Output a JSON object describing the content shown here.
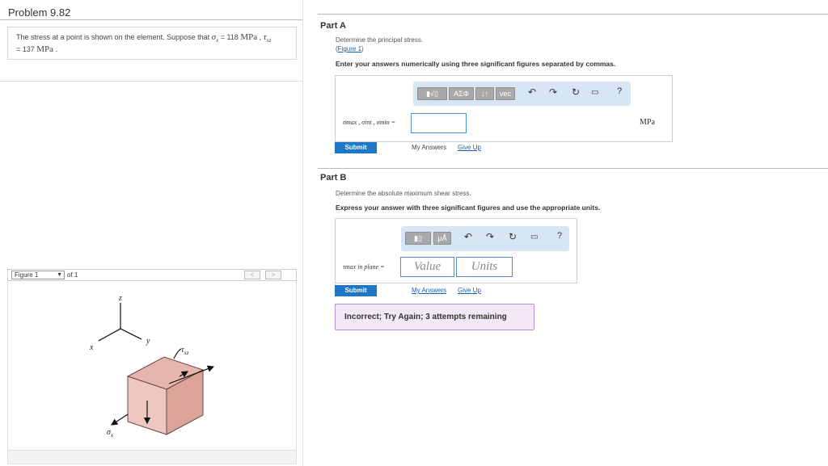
{
  "problem": {
    "title": "Problem 9.82"
  },
  "statement": {
    "text1": "The stress at a point is shown on the element. Suppose that ",
    "sigma_sym": "σ",
    "sigma_sub": "x",
    "sigma_val": " = 118 ",
    "unit": "MPa",
    "sep": " , ",
    "tau_sym": "τ",
    "tau_sub": "xz",
    "tau_val": " = 137 ",
    "end": " ."
  },
  "figure_panel": {
    "selector_value": "Figure 1",
    "of_text": "of 1",
    "prev": "<",
    "next": ">",
    "axis_z": "z",
    "axis_y": "y",
    "axis_x": "x",
    "tau_label": "τ",
    "tau_label_sub": "xz",
    "sigma_label": "σ",
    "sigma_label_sub": "x"
  },
  "partA": {
    "label": "Part A",
    "question": "Determine the principal stress.",
    "figure_link": "Figure 1",
    "instruction": "Enter your answers numerically using three significant figures separated by commas.",
    "toolbar": {
      "templates": "▮√▯",
      "greek": "ΑΣΦ",
      "arrows": "↓↑",
      "vec": "vec",
      "help": "?"
    },
    "answer_label": "σmax , σint , σmin =",
    "answer_value": "",
    "unit": "MPa",
    "submit": "Submit",
    "my_answers": "My Answers",
    "give_up": "Give Up"
  },
  "partB": {
    "label": "Part B",
    "question": "Determine the absolute maximum shear stress.",
    "instruction": "Express your answer with three significant figures and use the appropriate units.",
    "toolbar": {
      "templates": "▮▯",
      "units": "μÅ",
      "help": "?"
    },
    "answer_label": "τmax in plane =",
    "value_placeholder": "Value",
    "units_placeholder": "Units",
    "submit": "Submit",
    "my_answers": "My Answers",
    "give_up": "Give Up",
    "feedback": "Incorrect; Try Again; 3 attempts remaining"
  }
}
